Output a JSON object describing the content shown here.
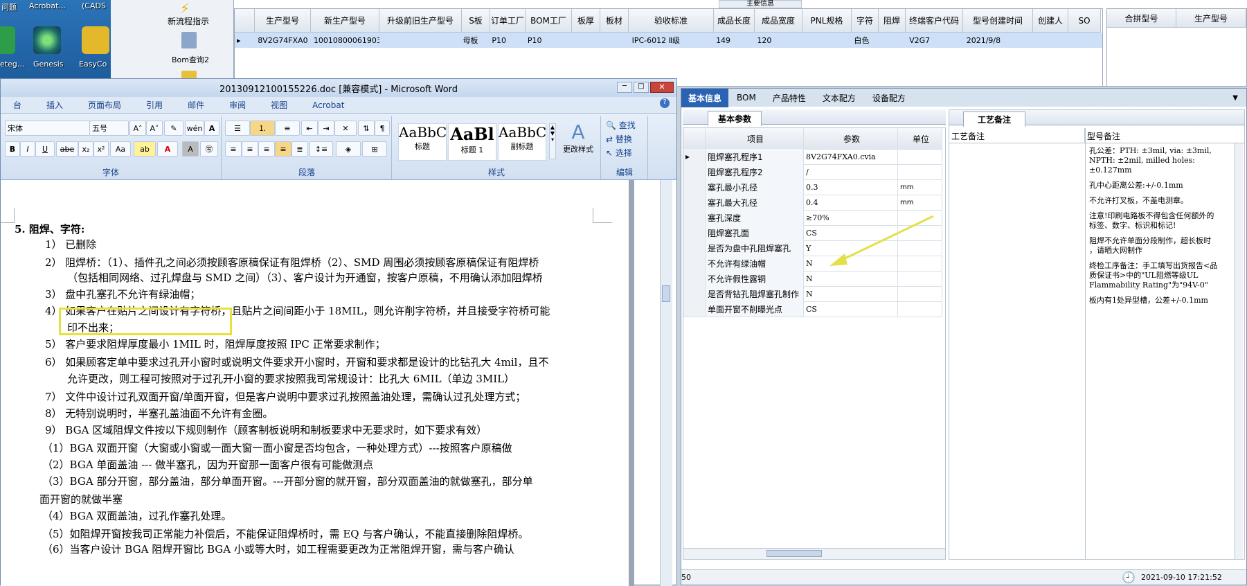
{
  "desktop": {
    "top_labels": [
      "问题",
      "Acrobat...",
      "(CADS"
    ],
    "icons": [
      {
        "label": "eteg..."
      },
      {
        "label": "Genesis"
      },
      {
        "label": "EasyCo"
      }
    ]
  },
  "side_panel": {
    "items": [
      "新流程指示",
      "Bom查询2"
    ]
  },
  "top_grid": {
    "group_label": "主要信息",
    "columns": [
      "生产型号",
      "新生产型号",
      "升级前旧生产型号",
      "S板",
      "订单工厂",
      "BOM工厂",
      "板厚",
      "板材",
      "验收标准",
      "成品长度",
      "成品宽度",
      "PNL规格",
      "字符",
      "阻焊",
      "终端客户代码",
      "型号创建时间",
      "创建人",
      "SO"
    ],
    "row": [
      "8V2G74FXA0",
      "10010800061903",
      "",
      "母板",
      "P10",
      "P10",
      "",
      "",
      "IPC-6012 Ⅱ级",
      "149",
      "120",
      "",
      "白色",
      "",
      "V2G7",
      "2021/9/8",
      "",
      ""
    ],
    "right_columns": [
      "合拼型号",
      "生产型号"
    ]
  },
  "word": {
    "title": "20130912100155226.doc [兼容模式] - Microsoft Word",
    "menu": [
      "台",
      "插入",
      "页面布局",
      "引用",
      "邮件",
      "审阅",
      "视图",
      "Acrobat"
    ],
    "font_name": "宋体",
    "font_size": "五号",
    "groups": [
      "字体",
      "段落",
      "样式",
      "编辑"
    ],
    "styles": [
      {
        "preview": "AaBbC",
        "name": "标题"
      },
      {
        "preview": "AaBl",
        "name": "标题 1"
      },
      {
        "preview": "AaBbC",
        "name": "副标题"
      }
    ],
    "change_style": "更改样式",
    "edit_items": [
      "查找",
      "替换",
      "选择"
    ],
    "doc_lines": [
      "5.   阻焊、字符:",
      "1） 已删除",
      "2） 阻焊桥：（1）、插件孔之间必须按顾客原稿保证有阻焊桥（2）、SMD 周围必须按顾客原稿保证有阻焊桥",
      "（包括相同网络、过孔焊盘与 SMD 之间）（3）、客户设计为开通窗，按客户原稿，不用确认添加阻焊桥",
      "3） 盘中孔塞孔不允许有绿油帽；",
      "4） 如果客户在贴片之间设计有字符桥，且贴片之间间距小于 18MIL，则允许削字符桥，并且接受字符桥可能",
      "印不出来；",
      "5） 客户要求阻焊厚度最小 1MIL 时，阻焊厚度按照 IPC 正常要求制作；",
      "6） 如果顾客定单中要求过孔开小窗时或说明文件要求开小窗时，开窗和要求都是设计的比钻孔大 4mil，且不",
      "允许更改，则工程可按照对于过孔开小窗的要求按照我司常规设计：比孔大 6MIL（单边 3MIL）",
      "7） 文件中设计过孔双面开窗/单面开窗，但是客户说明中要求过孔按照盖油处理，需确认过孔处理方式；",
      "8） 无特别说明时，半塞孔盖油面不允许有金圈。",
      "9） BGA 区域阻焊文件按以下规则制作（顾客制板说明和制板要求中无要求时，如下要求有效）",
      "（1）BGA 双面开窗（大窗或小窗或一面大窗一面小窗是否均包含，一种处理方式）---按照客户原稿做",
      "（2）BGA 单面盖油 --- 做半塞孔，因为开窗那一面客户很有可能做测点",
      "（3）BGA 部分开窗，部分盖油，部分单面开窗。---开部分窗的就开窗，部分双面盖油的就做塞孔，部分单",
      "面开窗的就做半塞",
      "（4）BGA 双面盖油，过孔作塞孔处理。",
      "（5）如阻焊开窗按我司正常能力补偿后，不能保证阻焊桥时，需 EQ 与客户确认，不能直接删除阻焊桥。",
      "（6）当客户设计 BGA 阻焊开窗比 BGA 小或等大时，如工程需要更改为正常阻焊开窗，需与客户确认"
    ]
  },
  "right_panel": {
    "tabs": [
      "基本信息",
      "BOM",
      "产品特性",
      "文本配方",
      "设备配方"
    ],
    "sub_tab": "基本参数",
    "param_headers": [
      "项目",
      "参数",
      "单位"
    ],
    "params": [
      {
        "item": "阻焊塞孔程序1",
        "value": "8V2G74FXA0.cvia",
        "unit": ""
      },
      {
        "item": "阻焊塞孔程序2",
        "value": "/",
        "unit": ""
      },
      {
        "item": "塞孔最小孔径",
        "value": "0.3",
        "unit": "mm"
      },
      {
        "item": "塞孔最大孔径",
        "value": "0.4",
        "unit": "mm"
      },
      {
        "item": "塞孔深度",
        "value": "≥70%",
        "unit": ""
      },
      {
        "item": "阻焊塞孔面",
        "value": "CS",
        "unit": ""
      },
      {
        "item": "是否为盘中孔阻焊塞孔",
        "value": "Y",
        "unit": ""
      },
      {
        "item": "不允许有绿油帽",
        "value": "N",
        "unit": ""
      },
      {
        "item": "不允许假性露铜",
        "value": "N",
        "unit": ""
      },
      {
        "item": "是否背钻孔阻焊塞孔制作",
        "value": "N",
        "unit": ""
      },
      {
        "item": "单面开窗不削曝光点",
        "value": "CS",
        "unit": ""
      }
    ],
    "process_tab": "工艺备注",
    "process_col": "工艺备注",
    "model_col": "型号备注",
    "model_notes": [
      "孔公差：PTH: ±3mil, via: ±3mil,",
      "NPTH: ±2mil, milled holes:",
      "±0.127mm",
      "",
      "孔中心距离公差:+/-0.1mm",
      "",
      "不允许打叉板，不盖电测章。",
      "",
      "注意!印刷电路板不得包含任何额外的",
      "标签、数字、标识和标记!",
      "",
      "阻焊不允许单面分段制作，超长板时",
      "，请晒大网制作",
      "",
      "终检工序备注：手工填写出货报告<品",
      "质保证书>中的\"UL阻燃等级UL",
      "Flammability Rating\"为\"94V-0\"",
      "",
      "板内有1处异型槽，公差+/-0.1mm"
    ],
    "status_time": "2021-09-10  17:21:52",
    "status_left": "50"
  },
  "colors": {
    "accent": "#2a62b4",
    "highlight": "#e9e13a",
    "arrow": "#e3e04a"
  }
}
